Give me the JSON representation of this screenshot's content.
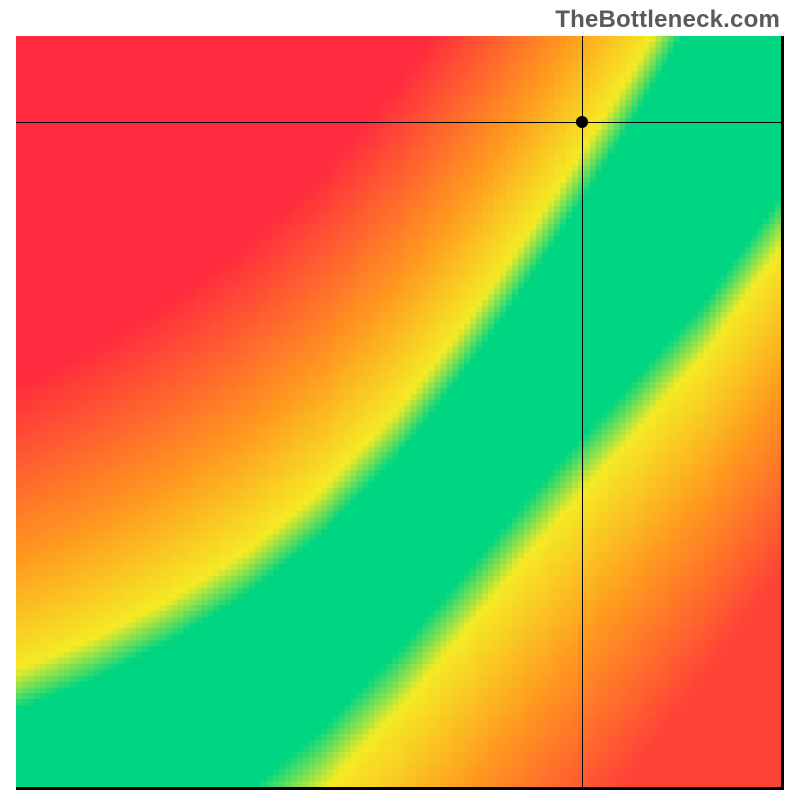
{
  "watermark": "TheBottleneck.com",
  "chart_data": {
    "type": "heatmap",
    "title": "",
    "xlabel": "",
    "ylabel": "",
    "xlim": [
      0,
      1
    ],
    "ylim": [
      0,
      1
    ],
    "grid_resolution": 128,
    "color_stops": [
      {
        "t": 0.0,
        "hex": "#00d582"
      },
      {
        "t": 0.18,
        "hex": "#00d582"
      },
      {
        "t": 0.28,
        "hex": "#f5ea24"
      },
      {
        "t": 0.55,
        "hex": "#ff9a1f"
      },
      {
        "t": 1.0,
        "hex": "#ff2a3e"
      }
    ],
    "curve": {
      "description": "Monotone increasing ideal-balance curve through the plot diagonal; heatmap color = distance from this curve.",
      "control_points_xy": [
        [
          0.0,
          0.0
        ],
        [
          0.1,
          0.04
        ],
        [
          0.2,
          0.09
        ],
        [
          0.3,
          0.15
        ],
        [
          0.4,
          0.23
        ],
        [
          0.5,
          0.33
        ],
        [
          0.6,
          0.45
        ],
        [
          0.7,
          0.58
        ],
        [
          0.8,
          0.71
        ],
        [
          0.9,
          0.85
        ],
        [
          1.0,
          1.0
        ]
      ],
      "band_halfwidth_fraction": 0.06
    },
    "crosshair": {
      "x": 0.74,
      "y": 0.885
    },
    "marker": {
      "x": 0.74,
      "y": 0.885
    }
  }
}
